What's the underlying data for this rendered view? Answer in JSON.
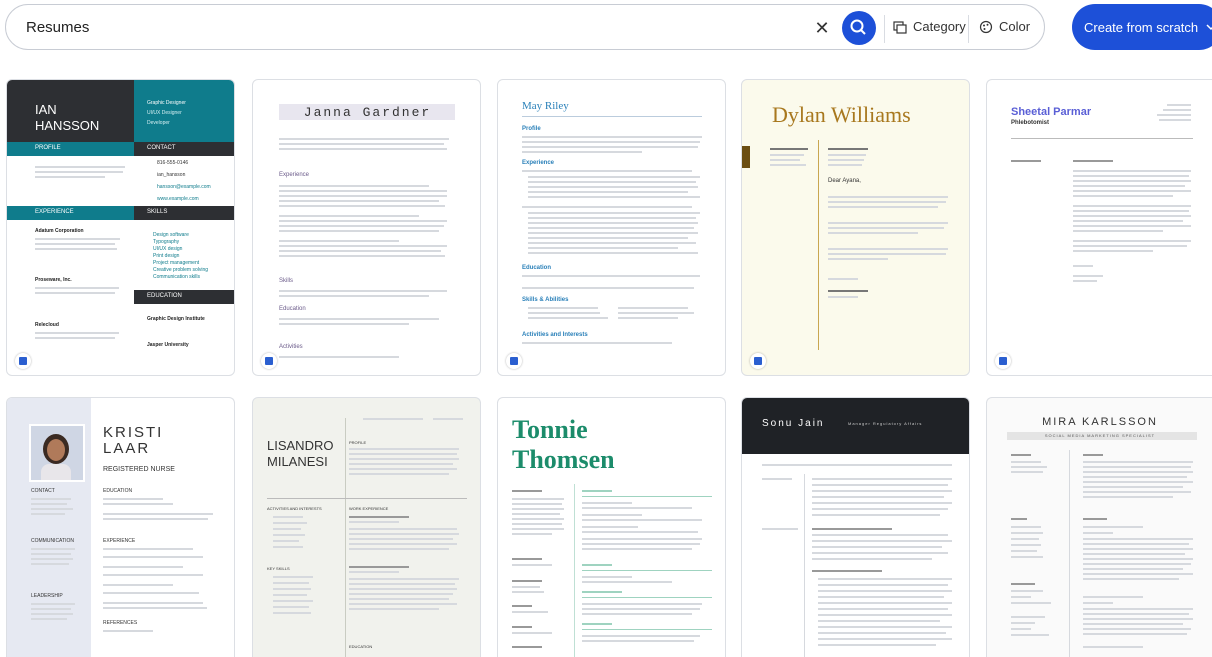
{
  "search": {
    "query": "Resumes",
    "clear_icon": "close-icon",
    "search_icon": "search-icon"
  },
  "filters": {
    "category": "Category",
    "color": "Color"
  },
  "create_button": {
    "label": "Create from scratch"
  },
  "colors": {
    "accent": "#1d50d8",
    "teal": "#0f7c8c",
    "dark": "#2d2f33",
    "gold": "#a8781e",
    "green": "#1c8c6b"
  },
  "cards": [
    {
      "name": "IAN HANSSON",
      "name_line1": "IAN",
      "name_line2": "HANSSON",
      "role1": "Graphic Designer",
      "role2": "UI/UX Designer",
      "role3": "Developer",
      "profile": "PROFILE",
      "contact": "CONTACT",
      "phone": "816-555-0146",
      "handle": "ian_hansson",
      "email": "hansson@example.com",
      "site": "www.example.com",
      "experience": "EXPERIENCE",
      "skills": "SKILLS",
      "job1": "Adatum Corporation",
      "job2": "Proseware, Inc.",
      "job3": "Relecloud",
      "skill_list": [
        "Design software",
        "Typography",
        "UI/UX design",
        "Print design",
        "Project management",
        "Creative problem solving",
        "Communication skills"
      ],
      "education": "EDUCATION",
      "school1": "Graphic Design Institute",
      "school2": "Jasper University"
    },
    {
      "name": "Janna Gardner",
      "sections": [
        "Experience",
        "Skills",
        "Education",
        "Activities"
      ]
    },
    {
      "name": "May Riley",
      "sections": [
        "Profile",
        "Experience",
        "Education",
        "Skills & Abilities",
        "Activities and Interests"
      ]
    },
    {
      "name": "Dylan Williams",
      "greeting": "Dear Ayana,"
    },
    {
      "name": "Sheetal Parmar",
      "role": "Phlebotomist"
    },
    {
      "name_line1": "KRISTI",
      "name_line2": "LAAR",
      "role": "REGISTERED NURSE",
      "sections": [
        "EDUCATION",
        "EXPERIENCE",
        "REFERENCES"
      ],
      "side": [
        "CONTACT",
        "COMMUNICATION",
        "LEADERSHIP"
      ]
    },
    {
      "name_line1": "LISANDRO",
      "name_line2": "MILANESI",
      "sections": [
        "PROFILE",
        "WORK EXPERIENCE",
        "EDUCATION"
      ],
      "side": [
        "ACTIVITIES AND INTERESTS",
        "KEY SKILLS"
      ]
    },
    {
      "name_line1": "Tonnie",
      "name_line2": "Thomsen"
    },
    {
      "name": "Sonu Jain",
      "role": "Manager Regulatory Affairs"
    },
    {
      "name": "MIRA KARLSSON",
      "role": "SOCIAL MEDIA MARKETING SPECIALIST"
    }
  ]
}
